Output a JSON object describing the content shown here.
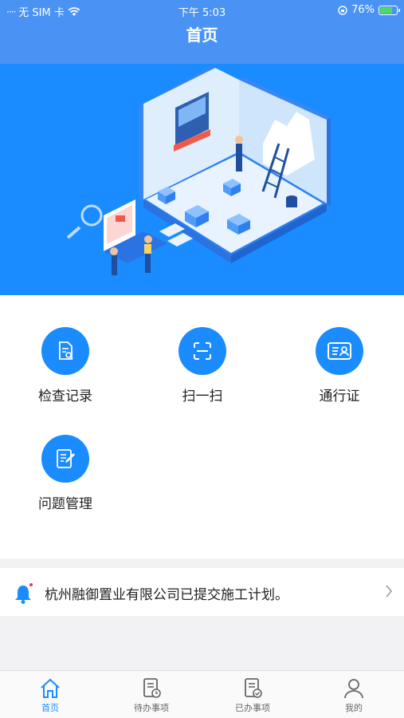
{
  "status_bar": {
    "carrier": "无 SIM 卡",
    "time": "下午 5:03",
    "battery": "76%"
  },
  "nav": {
    "title": "首页"
  },
  "grid": [
    {
      "label": "检查记录",
      "icon": "document-search-icon"
    },
    {
      "label": "扫一扫",
      "icon": "scan-icon"
    },
    {
      "label": "通行证",
      "icon": "id-card-icon"
    },
    {
      "label": "问题管理",
      "icon": "edit-document-icon"
    }
  ],
  "notice": {
    "text": "杭州融御置业有限公司已提交施工计划。"
  },
  "tabbar": [
    {
      "label": "首页",
      "icon": "home-icon"
    },
    {
      "label": "待办事项",
      "icon": "pending-doc-icon"
    },
    {
      "label": "已办事项",
      "icon": "done-doc-icon"
    },
    {
      "label": "我的",
      "icon": "user-icon"
    }
  ],
  "colors": {
    "primary": "#1a8cff",
    "nav": "#4a93f4",
    "battery": "#4cd964"
  }
}
